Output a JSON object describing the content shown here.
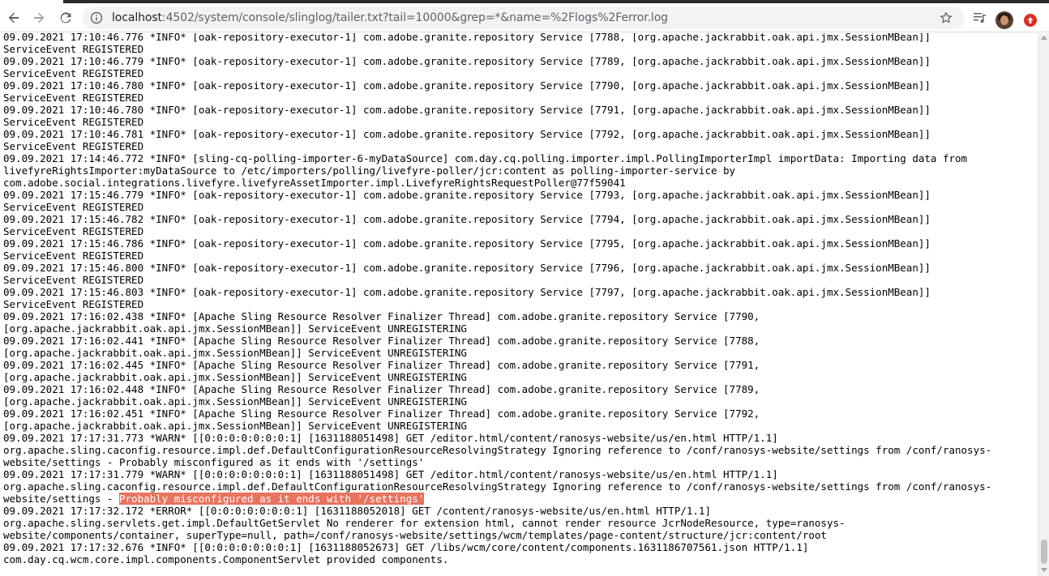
{
  "browser": {
    "url_host": "localhost",
    "url_rest": ":4502/system/console/slinglog/tailer.txt?tail=10000&grep=*&name=%2Flogs%2Ferror.log",
    "icons": {
      "back": "back-arrow-icon",
      "forward": "forward-arrow-icon",
      "reload": "reload-icon",
      "info": "site-info-icon",
      "bookmark": "bookmark-star-icon",
      "media": "media-control-icon",
      "profile": "profile-avatar",
      "update": "update-available-icon"
    },
    "colors": {
      "update": "#d93025",
      "highlight": "#e8735f"
    }
  },
  "log": {
    "lines": [
      "09.09.2021 17:10:46.776 *INFO* [oak-repository-executor-1] com.adobe.granite.repository Service [7788, [org.apache.jackrabbit.oak.api.jmx.SessionMBean]]",
      "ServiceEvent REGISTERED",
      "09.09.2021 17:10:46.779 *INFO* [oak-repository-executor-1] com.adobe.granite.repository Service [7789, [org.apache.jackrabbit.oak.api.jmx.SessionMBean]]",
      "ServiceEvent REGISTERED",
      "09.09.2021 17:10:46.780 *INFO* [oak-repository-executor-1] com.adobe.granite.repository Service [7790, [org.apache.jackrabbit.oak.api.jmx.SessionMBean]]",
      "ServiceEvent REGISTERED",
      "09.09.2021 17:10:46.780 *INFO* [oak-repository-executor-1] com.adobe.granite.repository Service [7791, [org.apache.jackrabbit.oak.api.jmx.SessionMBean]]",
      "ServiceEvent REGISTERED",
      "09.09.2021 17:10:46.781 *INFO* [oak-repository-executor-1] com.adobe.granite.repository Service [7792, [org.apache.jackrabbit.oak.api.jmx.SessionMBean]]",
      "ServiceEvent REGISTERED",
      "09.09.2021 17:14:46.772 *INFO* [sling-cq-polling-importer-6-myDataSource] com.day.cq.polling.importer.impl.PollingImporterImpl importData: Importing data from",
      "livefyreRightsImporter:myDataSource to /etc/importers/polling/livefyre-poller/jcr:content as polling-importer-service by",
      "com.adobe.social.integrations.livefyre.livefyreAssetImporter.impl.LivefyreRightsRequestPoller@77f59041",
      "09.09.2021 17:15:46.779 *INFO* [oak-repository-executor-1] com.adobe.granite.repository Service [7793, [org.apache.jackrabbit.oak.api.jmx.SessionMBean]]",
      "ServiceEvent REGISTERED",
      "09.09.2021 17:15:46.782 *INFO* [oak-repository-executor-1] com.adobe.granite.repository Service [7794, [org.apache.jackrabbit.oak.api.jmx.SessionMBean]]",
      "ServiceEvent REGISTERED",
      "09.09.2021 17:15:46.786 *INFO* [oak-repository-executor-1] com.adobe.granite.repository Service [7795, [org.apache.jackrabbit.oak.api.jmx.SessionMBean]]",
      "ServiceEvent REGISTERED",
      "09.09.2021 17:15:46.800 *INFO* [oak-repository-executor-1] com.adobe.granite.repository Service [7796, [org.apache.jackrabbit.oak.api.jmx.SessionMBean]]",
      "ServiceEvent REGISTERED",
      "09.09.2021 17:15:46.803 *INFO* [oak-repository-executor-1] com.adobe.granite.repository Service [7797, [org.apache.jackrabbit.oak.api.jmx.SessionMBean]]",
      "ServiceEvent REGISTERED",
      "09.09.2021 17:16:02.438 *INFO* [Apache Sling Resource Resolver Finalizer Thread] com.adobe.granite.repository Service [7790,",
      "[org.apache.jackrabbit.oak.api.jmx.SessionMBean]] ServiceEvent UNREGISTERING",
      "09.09.2021 17:16:02.441 *INFO* [Apache Sling Resource Resolver Finalizer Thread] com.adobe.granite.repository Service [7788,",
      "[org.apache.jackrabbit.oak.api.jmx.SessionMBean]] ServiceEvent UNREGISTERING",
      "09.09.2021 17:16:02.445 *INFO* [Apache Sling Resource Resolver Finalizer Thread] com.adobe.granite.repository Service [7791,",
      "[org.apache.jackrabbit.oak.api.jmx.SessionMBean]] ServiceEvent UNREGISTERING",
      "09.09.2021 17:16:02.448 *INFO* [Apache Sling Resource Resolver Finalizer Thread] com.adobe.granite.repository Service [7789,",
      "[org.apache.jackrabbit.oak.api.jmx.SessionMBean]] ServiceEvent UNREGISTERING",
      "09.09.2021 17:16:02.451 *INFO* [Apache Sling Resource Resolver Finalizer Thread] com.adobe.granite.repository Service [7792,",
      "[org.apache.jackrabbit.oak.api.jmx.SessionMBean]] ServiceEvent UNREGISTERING",
      "09.09.2021 17:17:31.773 *WARN* [[0:0:0:0:0:0:0:1] [1631188051498] GET /editor.html/content/ranosys-website/us/en.html HTTP/1.1]",
      "org.apache.sling.caconfig.resource.impl.def.DefaultConfigurationResourceResolvingStrategy Ignoring reference to /conf/ranosys-website/settings from /conf/ranosys-",
      "website/settings - Probably misconfigured as it ends with '/settings'",
      "09.09.2021 17:17:31.779 *WARN* [[0:0:0:0:0:0:0:1] [1631188051498] GET /editor.html/content/ranosys-website/us/en.html HTTP/1.1]",
      "org.apache.sling.caconfig.resource.impl.def.DefaultConfigurationResourceResolvingStrategy Ignoring reference to /conf/ranosys-website/settings from /conf/ranosys-"
    ],
    "highlight_prefix": "website/settings - ",
    "highlight_text": "Probably misconfigured as it ends with '/settings'",
    "lines_after": [
      "09.09.2021 17:17:32.172 *ERROR* [[0:0:0:0:0:0:0:1] [1631188052018] GET /content/ranosys-website/us/en.html HTTP/1.1]",
      "org.apache.sling.servlets.get.impl.DefaultGetServlet No renderer for extension html, cannot render resource JcrNodeResource, type=ranosys-",
      "website/components/container, superType=null, path=/conf/ranosys-website/settings/wcm/templates/page-content/structure/jcr:content/root",
      "09.09.2021 17:17:32.676 *INFO* [[0:0:0:0:0:0:0:1] [1631188052673] GET /libs/wcm/core/content/components.1631186707561.json HTTP/1.1]",
      "com.day.cq.wcm.core.impl.components.ComponentServlet provided components."
    ]
  }
}
